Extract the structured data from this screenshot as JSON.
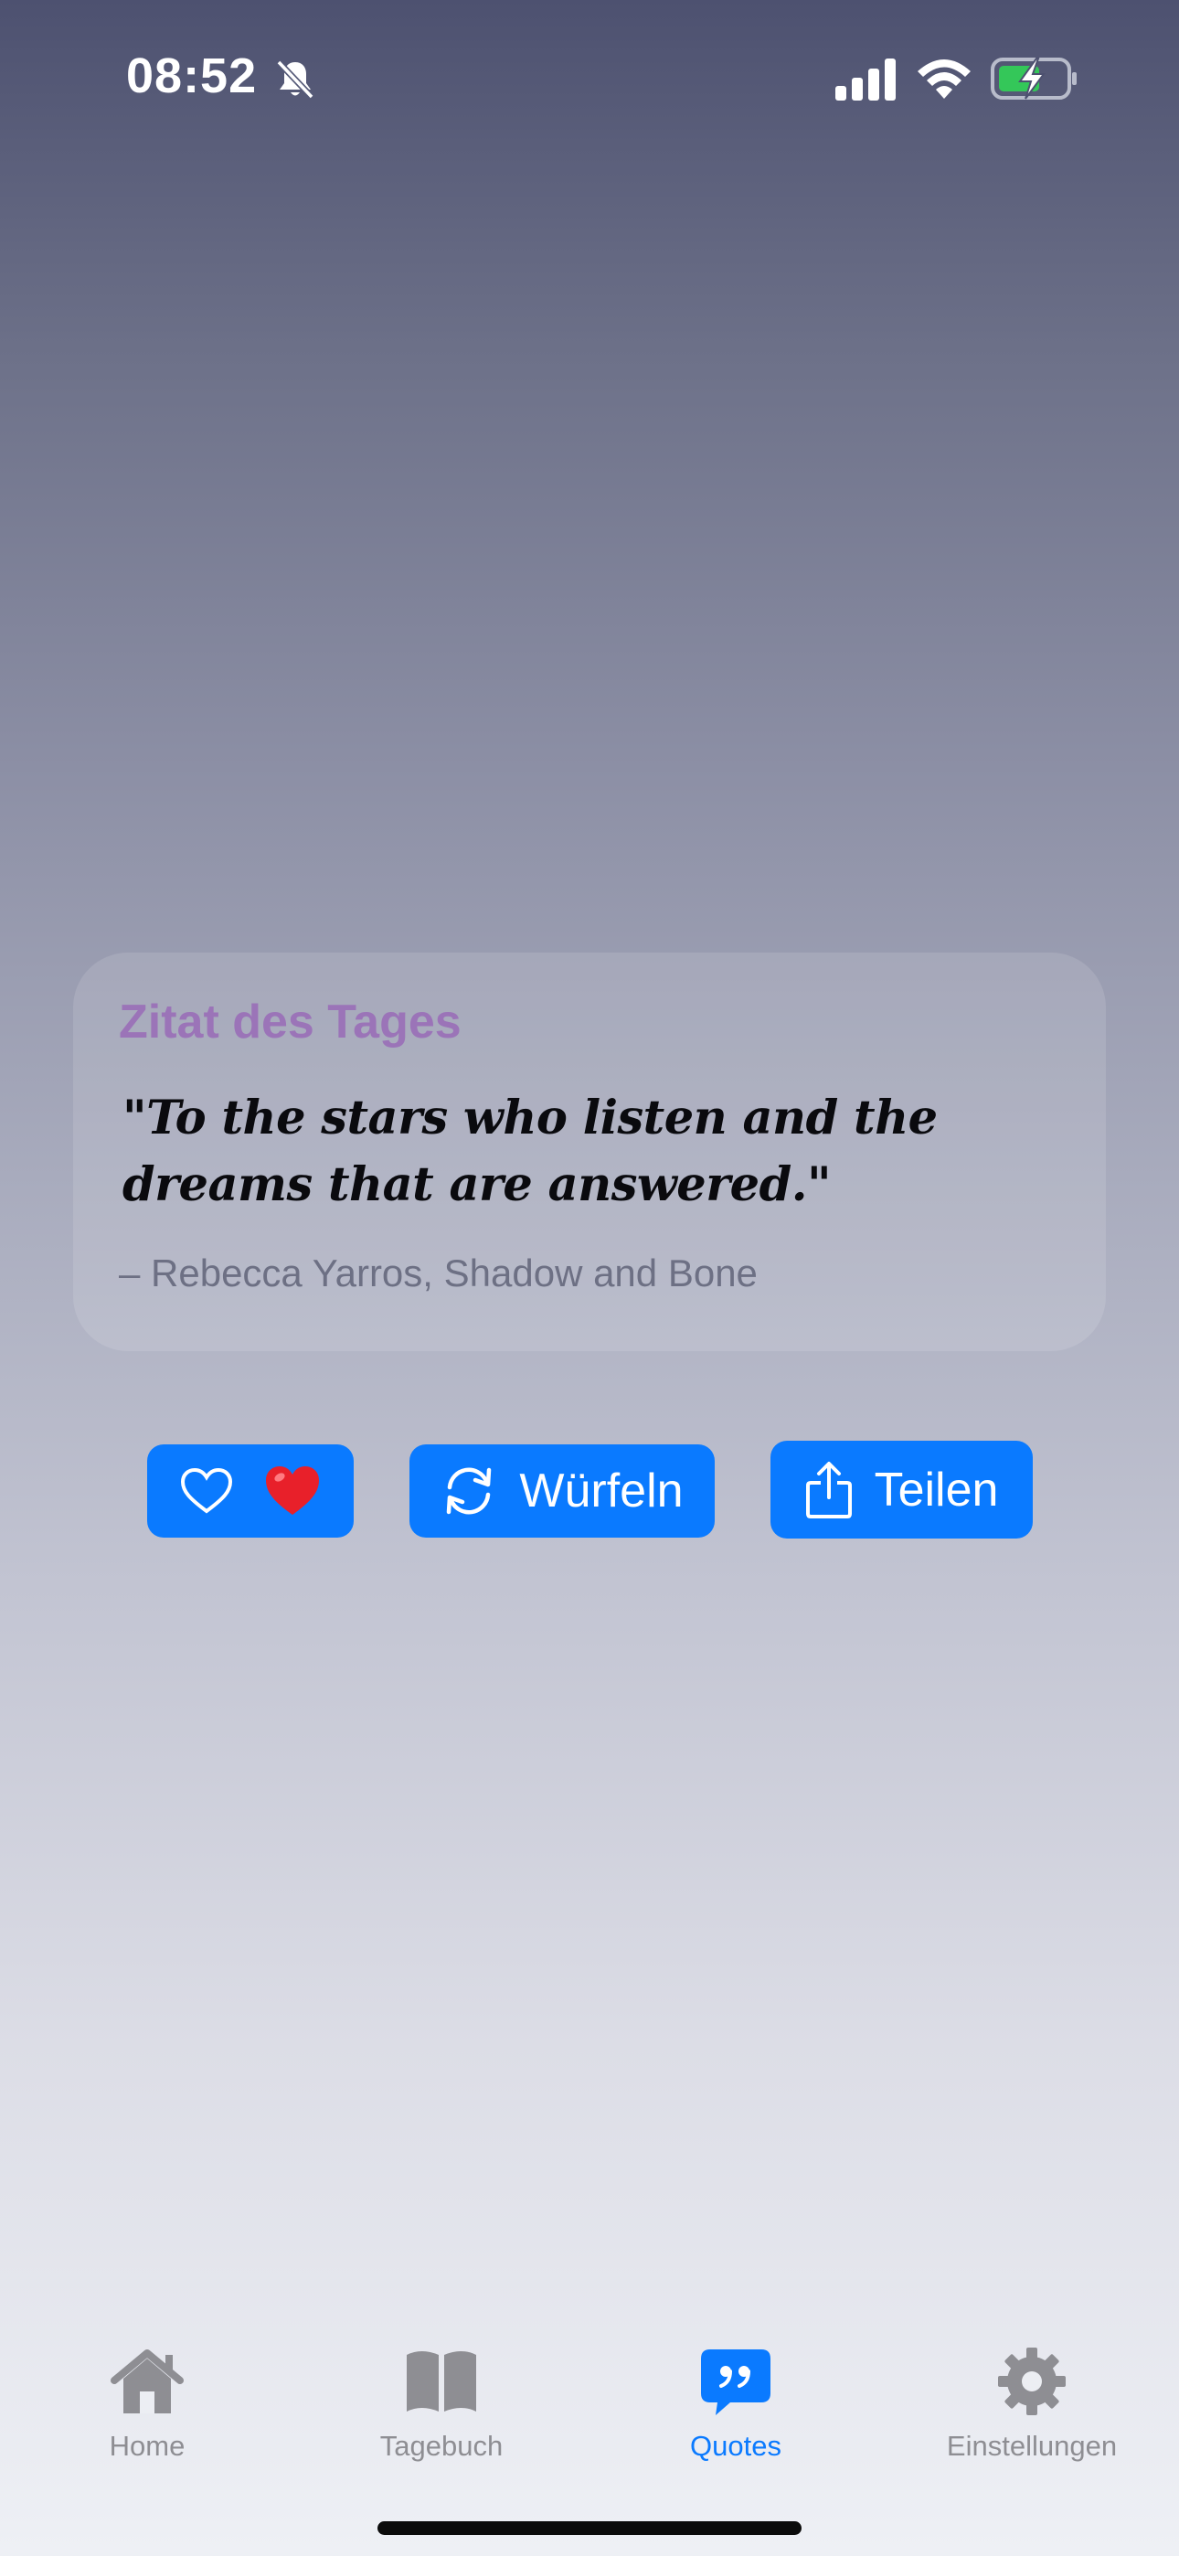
{
  "status_bar": {
    "time": "08:52",
    "icons": [
      "bell-slash-icon",
      "cellular-signal-icon",
      "wifi-icon",
      "battery-charging-icon"
    ]
  },
  "quote_card": {
    "title": "Zitat des Tages",
    "quote": "\"To the stars who listen and the dreams that are answered.\"",
    "author": "– Rebecca Yarros, Shadow and Bone"
  },
  "actions": {
    "favorite": {
      "icons": [
        "heart-outline-icon",
        "red-heart-emoji"
      ]
    },
    "roll": {
      "label": "Würfeln",
      "icon": "refresh-arrows-icon"
    },
    "share": {
      "label": "Teilen",
      "icon": "share-icon"
    }
  },
  "tab_bar": {
    "items": [
      {
        "label": "Home",
        "icon": "house-icon",
        "active": false
      },
      {
        "label": "Tagebuch",
        "icon": "book-icon",
        "active": false
      },
      {
        "label": "Quotes",
        "icon": "quote-bubble-icon",
        "active": true
      },
      {
        "label": "Einstellungen",
        "icon": "gear-icon",
        "active": false
      }
    ]
  },
  "colors": {
    "accent": "#0a7aff",
    "title_purple": "#9b74b8",
    "inactive_tab": "#8e8e93",
    "heart_red": "#e8202a"
  }
}
